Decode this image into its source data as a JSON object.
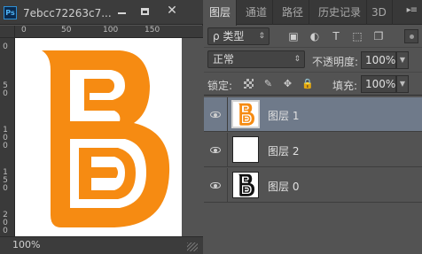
{
  "document": {
    "app_logo": "Ps",
    "title": "7ebcc72263c7...",
    "window_controls": {
      "minimize_icon": "minimize-icon",
      "maximize_icon": "maximize-icon",
      "close_icon": "close-icon",
      "close_glyph": "✕"
    },
    "ruler_top_labels": [
      "0",
      "50",
      "100",
      "150"
    ],
    "ruler_left_labels": [
      "0",
      "50",
      "100",
      "150",
      "200"
    ],
    "zoom": "100%",
    "logo_color": "#f68b12"
  },
  "panel": {
    "tabs": [
      {
        "label": "图层",
        "active": true
      },
      {
        "label": "通道",
        "active": false
      },
      {
        "label": "路径",
        "active": false
      },
      {
        "label": "历史记录",
        "active": false
      },
      {
        "label": "3D",
        "active": false
      }
    ],
    "menu_glyph": "▸≡",
    "filter": {
      "label": "ρ 类型",
      "arrow": "⇕"
    },
    "filter_icons": [
      "image-filter-icon",
      "adjustment-filter-icon",
      "type-filter-icon",
      "shape-filter-icon",
      "smart-object-filter-icon"
    ],
    "filter_glyphs": [
      "▣",
      "◐",
      "T",
      "⬚",
      "❐"
    ],
    "blend_mode": "正常",
    "blend_arrow": "⇕",
    "opacity_label": "不透明度:",
    "opacity_value": "100%",
    "lock_label": "锁定:",
    "lock_glyphs": [
      "",
      "✎",
      "✥",
      "🔒"
    ],
    "fill_label": "填充:",
    "fill_value": "100%",
    "dropdown_glyph": "▼",
    "layers": [
      {
        "name": "图层 1",
        "selected": true
      },
      {
        "name": "图层 2",
        "selected": false
      },
      {
        "name": "图层 0",
        "selected": false
      }
    ]
  }
}
